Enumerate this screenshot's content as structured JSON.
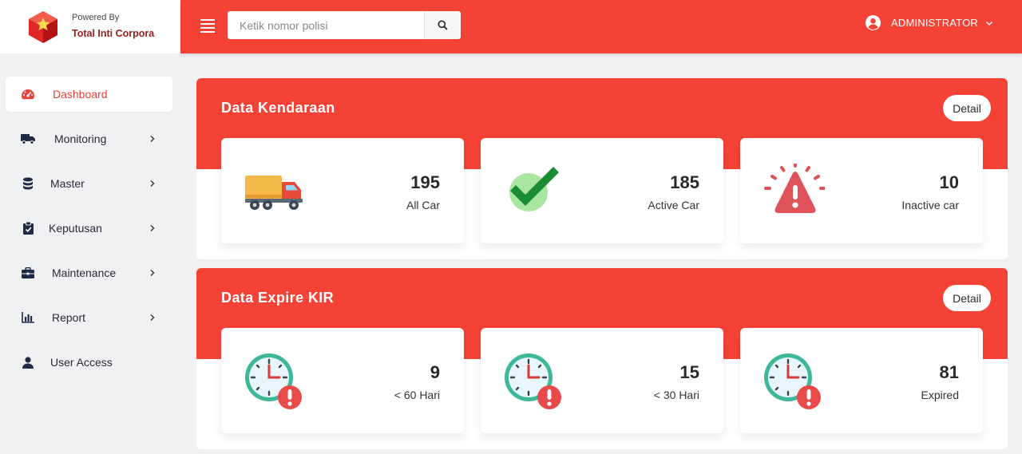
{
  "brand": {
    "powered_by": "Powered By",
    "company": "Total Inti Corpora",
    "primary_color": "#f44336"
  },
  "sidebar": {
    "items": [
      {
        "label": "Dashboard",
        "icon": "speedometer-icon",
        "active": true,
        "has_submenu": false
      },
      {
        "label": "Monitoring",
        "icon": "truck-icon",
        "active": false,
        "has_submenu": true
      },
      {
        "label": "Master",
        "icon": "database-icon",
        "active": false,
        "has_submenu": true
      },
      {
        "label": "Keputusan",
        "icon": "clipboard-check-icon",
        "active": false,
        "has_submenu": true
      },
      {
        "label": "Maintenance",
        "icon": "briefcase-icon",
        "active": false,
        "has_submenu": true
      },
      {
        "label": "Report",
        "icon": "bar-chart-icon",
        "active": false,
        "has_submenu": true
      },
      {
        "label": "User Access",
        "icon": "user-icon",
        "active": false,
        "has_submenu": false
      }
    ]
  },
  "header": {
    "search_placeholder": "Ketik nomor polisi",
    "user_name": "ADMINISTRATOR"
  },
  "panels": [
    {
      "title": "Data Kendaraan",
      "detail_label": "Detail",
      "cards": [
        {
          "value": "195",
          "caption": "All Car",
          "icon": "delivery-truck-icon"
        },
        {
          "value": "185",
          "caption": "Active Car",
          "icon": "green-checkmark-icon"
        },
        {
          "value": "10",
          "caption": "Inactive car",
          "icon": "warning-alert-icon"
        }
      ]
    },
    {
      "title": "Data Expire KIR",
      "detail_label": "Detail",
      "cards": [
        {
          "value": "9",
          "caption": "< 60 Hari",
          "icon": "clock-alert-icon"
        },
        {
          "value": "15",
          "caption": "< 30 Hari",
          "icon": "clock-alert-icon"
        },
        {
          "value": "81",
          "caption": "Expired",
          "icon": "clock-alert-icon"
        }
      ]
    }
  ]
}
